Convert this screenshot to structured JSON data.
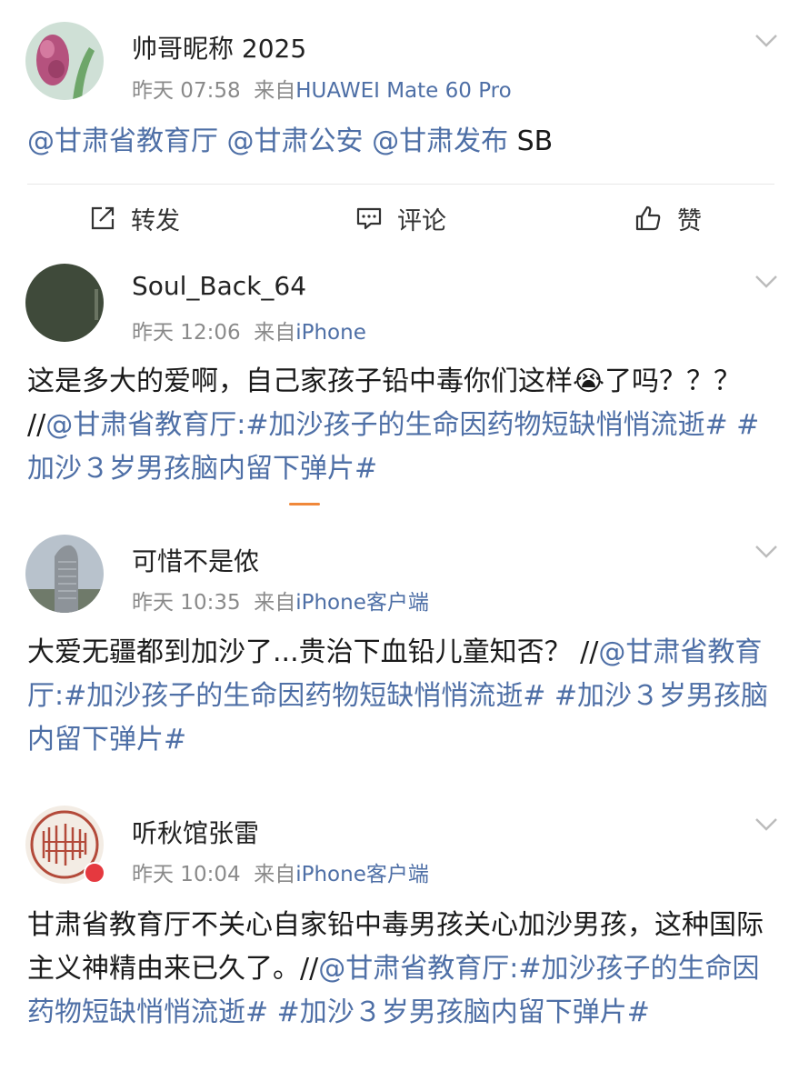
{
  "posts": [
    {
      "username": "帅哥昵称 2025",
      "time": "昨天 07:58",
      "from": "来自",
      "device": "HUAWEI Mate 60 Pro",
      "content": [
        {
          "text": "@甘肃省教育厅 @甘肃公安 @甘肃发布",
          "link": true
        },
        {
          "text": " SB",
          "link": false
        }
      ]
    },
    {
      "username": "Soul_Back_64",
      "time": "昨天 12:06",
      "from": "来自",
      "device": "iPhone",
      "content": [
        {
          "text": "这是多大的爱啊，自己家孩子铅中毒你们这样",
          "link": false
        },
        {
          "text": "😭",
          "link": false
        },
        {
          "text": "了吗？？？ //",
          "link": false
        },
        {
          "text": "@甘肃省教育厅:#加沙孩子的生命因药物短缺悄悄流逝# #加沙３岁男孩脑内留下弹片#",
          "link": true
        }
      ]
    },
    {
      "username": "可惜不是侬",
      "time": "昨天 10:35",
      "from": "来自",
      "device": "iPhone客户端",
      "content": [
        {
          "text": "大爱无疆都到加沙了...贵治下血铅儿童知否？ //",
          "link": false
        },
        {
          "text": "@甘肃省教育厅:#加沙孩子的生命因药物短缺悄悄流逝# #加沙３岁男孩脑内留下弹片#",
          "link": true
        }
      ]
    },
    {
      "username": "听秋馆张雷",
      "time": "昨天 10:04",
      "from": "来自",
      "device": "iPhone客户端",
      "content": [
        {
          "text": "甘肃省教育厅不关心自家铅中毒男孩关心加沙男孩，这种国际主义神精由来已久了。//",
          "link": false
        },
        {
          "text": "@甘肃省教育厅:#加沙孩子的生命因药物短缺悄悄流逝# #加沙３岁男孩脑内留下弹片#",
          "link": true
        }
      ]
    }
  ],
  "actions": {
    "repost": "转发",
    "comment": "评论",
    "like": "赞"
  },
  "icons": [
    "chevron-down-icon",
    "repost-icon",
    "comment-icon",
    "thumbs-up-icon",
    "verified-badge-icon"
  ],
  "colors": {
    "link": "#4e6fa6",
    "meta": "#8a8a8a",
    "accent": "#f0883a",
    "badge": "#e5393f"
  }
}
